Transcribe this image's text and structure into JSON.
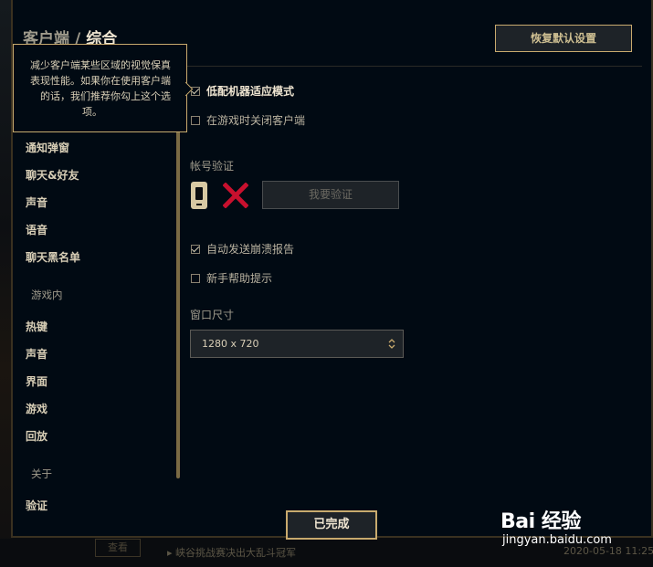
{
  "background": {
    "view_button": "查看",
    "news_text": "峡谷挑战赛决出大乱斗冠军",
    "date_text": "2020-05-18 11:25"
  },
  "breadcrumb": {
    "section": "客户端",
    "separator": "/",
    "current": "综合"
  },
  "header": {
    "restore_defaults_label": "恢复默认设置"
  },
  "tooltip": {
    "lines": [
      "减少客户端某些区域的视觉保真",
      "表现性能。如果你在使用客户端",
      "的话，我们推荐你勾上这个选",
      "项。"
    ]
  },
  "sidebar": {
    "items_top": [
      {
        "label": "通知弹窗"
      },
      {
        "label": "聊天&好友"
      },
      {
        "label": "声音"
      },
      {
        "label": "语音"
      },
      {
        "label": "聊天黑名单"
      }
    ],
    "in_game_heading": "游戏内",
    "items_game": [
      {
        "label": "热键"
      },
      {
        "label": "声音"
      },
      {
        "label": "界面"
      },
      {
        "label": "游戏"
      },
      {
        "label": "回放"
      }
    ],
    "about_heading": "关于",
    "items_about": [
      {
        "label": "验证"
      }
    ]
  },
  "settings": {
    "low_spec_mode": {
      "label": "低配机器适应模式",
      "checked": true
    },
    "close_client_in_game": {
      "label": "在游戏时关闭客户端",
      "checked": false
    },
    "account_verify": {
      "heading": "帐号验证",
      "verify_button": "我要验证",
      "phone_icon": "phone-icon",
      "status_icon": "x-icon",
      "status_color": "#c8102e"
    },
    "auto_crash_report": {
      "label": "自动发送崩溃报告",
      "checked": true
    },
    "newbie_tips": {
      "label": "新手帮助提示",
      "checked": false
    },
    "window_size": {
      "heading": "窗口尺寸",
      "value": "1280 x 720"
    }
  },
  "footer": {
    "done_label": "已完成"
  },
  "watermark": {
    "brand": "Bai 经验",
    "url": "jingyan.baidu.com"
  }
}
